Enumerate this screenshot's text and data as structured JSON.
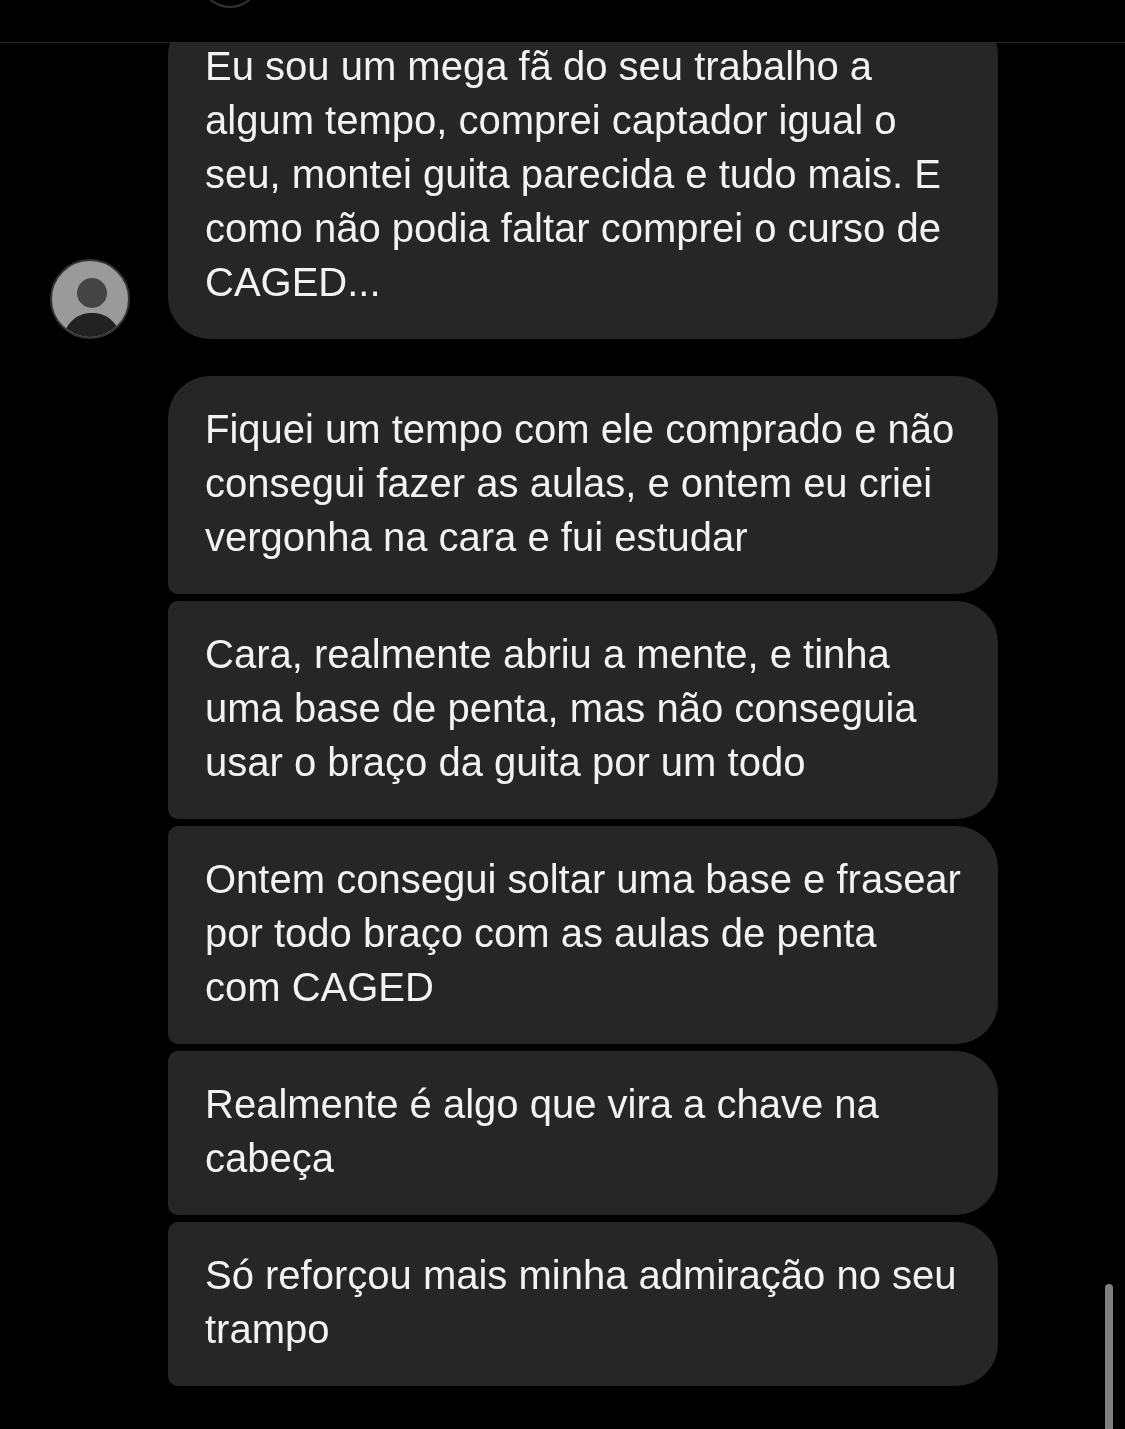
{
  "groups": [
    {
      "show_avatar": true,
      "messages": [
        "Eu sou um mega fã do seu trabalho a algum tempo, comprei captador igual o seu, montei guita parecida e tudo mais. E como não podia faltar comprei o curso de CAGED..."
      ]
    },
    {
      "show_avatar": false,
      "messages": [
        "Fiquei um tempo com ele comprado e não consegui fazer as aulas, e ontem eu criei vergonha na cara e fui estudar",
        "Cara, realmente abriu a mente, e tinha uma base de penta, mas não conseguia usar o braço da guita por um todo",
        "Ontem consegui soltar uma base e frasear por todo braço com as aulas de penta com CAGED",
        "Realmente é algo que vira a chave na cabeça",
        "Só reforçou mais minha admiração no seu trampo"
      ]
    }
  ]
}
